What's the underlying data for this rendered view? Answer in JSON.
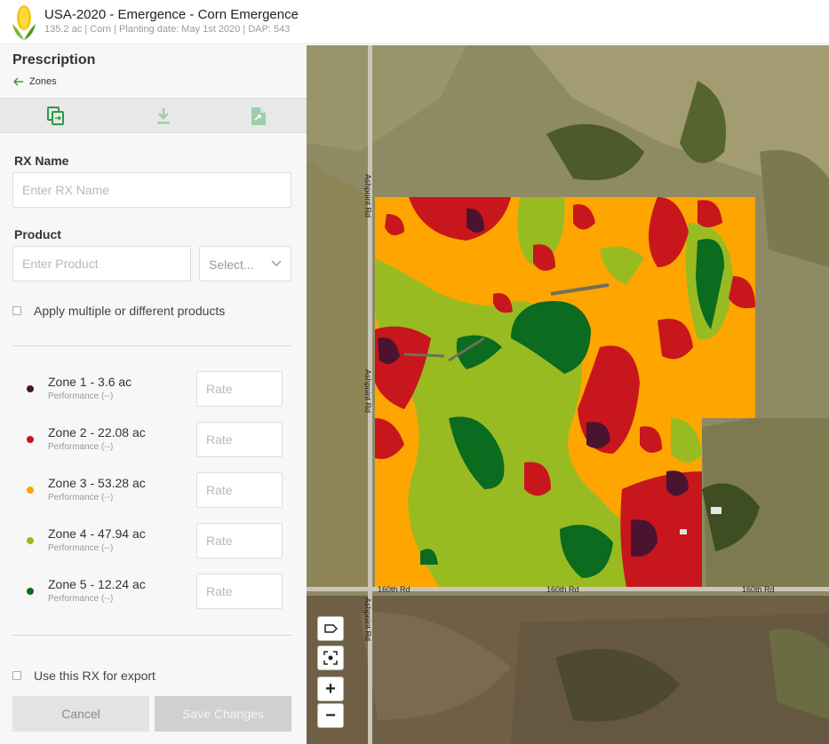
{
  "header": {
    "title": "USA-2020 - Emergence - Corn Emergence",
    "subtitle": "135.2 ac | Corn | Planting date: May 1st 2020 | DAP: 543"
  },
  "panel": {
    "title": "Prescription",
    "back_label": "Zones",
    "rx_name_label": "RX Name",
    "rx_name_placeholder": "Enter RX Name",
    "product_label": "Product",
    "product_placeholder": "Enter Product",
    "select_value": "Select...",
    "multi_products_label": "Apply multiple or different products",
    "use_export_label": "Use this RX for export",
    "cancel_label": "Cancel",
    "save_label": "Save Changes"
  },
  "zones": [
    {
      "name": "Zone 1 - 3.6 ac",
      "perf": "Performance (--)",
      "color": "#4a1431",
      "rate_placeholder": "Rate"
    },
    {
      "name": "Zone 2 - 22.08 ac",
      "perf": "Performance (--)",
      "color": "#c8161d",
      "rate_placeholder": "Rate"
    },
    {
      "name": "Zone 3 - 53.28 ac",
      "perf": "Performance (--)",
      "color": "#ffa500",
      "rate_placeholder": "Rate"
    },
    {
      "name": "Zone 4 - 47.94 ac",
      "perf": "Performance (--)",
      "color": "#99bb22",
      "rate_placeholder": "Rate"
    },
    {
      "name": "Zone 5 - 12.24 ac",
      "perf": "Performance (--)",
      "color": "#0b6b1e",
      "rate_placeholder": "Rate"
    }
  ],
  "map": {
    "road_labels": [
      "Ashpoint Rd",
      "Ashpoint Rd",
      "Ashpoint Rd",
      "160th Rd",
      "160th Rd",
      "160th Rd"
    ],
    "zoom_in": "+",
    "zoom_out": "−"
  },
  "colors": {
    "accent": "#2e9a44",
    "zone1": "#4a1431",
    "zone2": "#c8161d",
    "zone3": "#ffa500",
    "zone4": "#99bb22",
    "zone5": "#0b6b1e"
  }
}
